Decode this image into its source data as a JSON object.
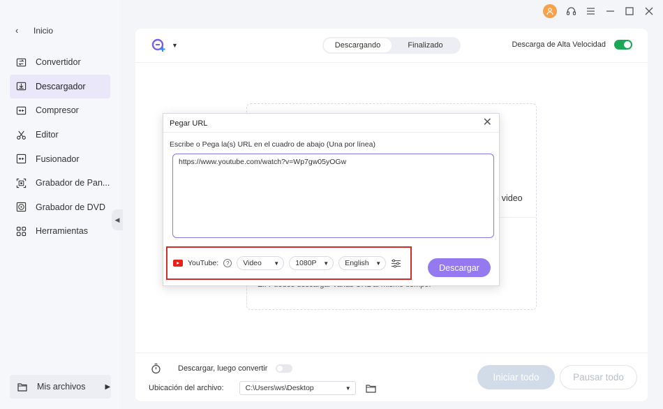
{
  "sidebar": {
    "back_label": "Inicio",
    "items": [
      {
        "label": "Convertidor",
        "icon": "convert-icon"
      },
      {
        "label": "Descargador",
        "icon": "download-icon",
        "active": true
      },
      {
        "label": "Compresor",
        "icon": "compress-icon"
      },
      {
        "label": "Editor",
        "icon": "scissors-icon"
      },
      {
        "label": "Fusionador",
        "icon": "merge-icon"
      },
      {
        "label": "Grabador de Pan...",
        "icon": "screen-record-icon"
      },
      {
        "label": "Grabador de DVD",
        "icon": "dvd-icon"
      },
      {
        "label": "Herramientas",
        "icon": "grid-icon"
      }
    ],
    "files_label": "Mis archivos"
  },
  "header": {
    "tabs": [
      "Descargando",
      "Finalizado"
    ],
    "speed_label": "Descarga de Alta Velocidad",
    "speed_enabled": true
  },
  "dropzone": {
    "text_fragment": "y video",
    "hint_fragment": "Ei. Puedes descargar varias URL al mismo tiempo."
  },
  "footer": {
    "convert_label": "Descargar, luego convertir",
    "location_label": "Ubicación del archivo:",
    "location_value": "C:\\Users\\ws\\Desktop",
    "start_all": "Iniciar todo",
    "pause_all": "Pausar todo"
  },
  "modal": {
    "title": "Pegar URL",
    "description": "Escribe o Pega la(s) URL en el cuadro de abajo (Una por línea)",
    "url": "https://www.youtube.com/watch?v=Wp7gw05yOGw",
    "source_label": "YouTube:",
    "format": "Video",
    "quality": "1080P",
    "language": "English",
    "download_button": "Descargar"
  },
  "colors": {
    "accent": "#9479f0",
    "toggle_on": "#1aa856",
    "highlight_border": "#d62a2a"
  }
}
